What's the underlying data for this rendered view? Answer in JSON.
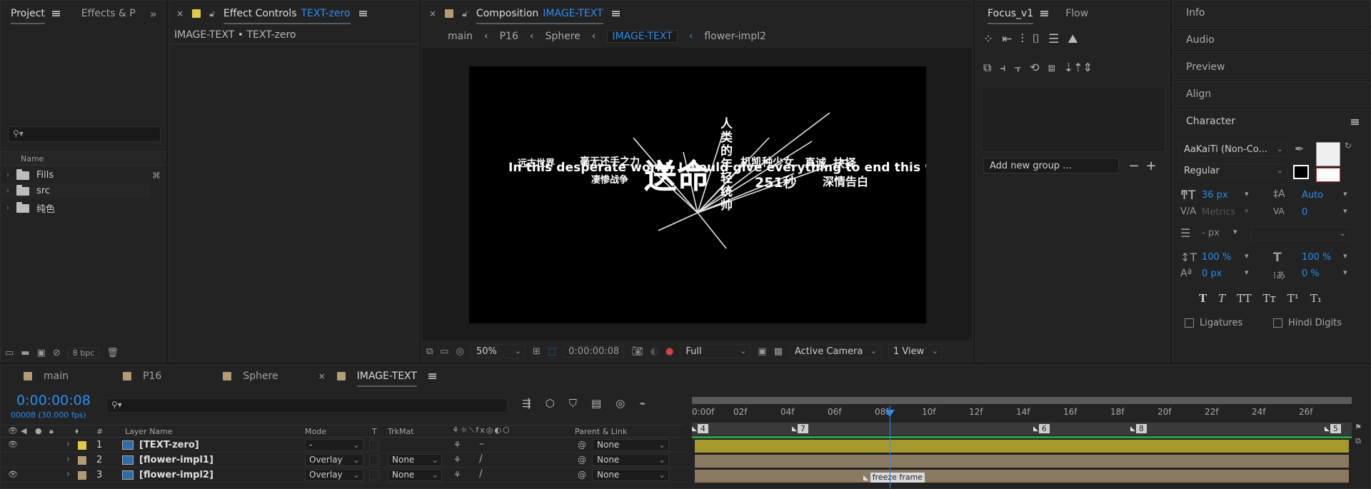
{
  "colors": {
    "accent": "#2d8ceb",
    "label_yellow": "#e0c84a",
    "label_tan": "#b59b73",
    "layer_bar_yellow": "#a7982e",
    "layer_bar_tan": "#8a7a62",
    "green_bar": "#2aa14a"
  },
  "project": {
    "tabs": [
      {
        "label": "Project"
      },
      {
        "label": "Effects & P"
      }
    ],
    "search_placeholder": "",
    "col_name": "Name",
    "items": [
      {
        "label": "Fills"
      },
      {
        "label": "src"
      },
      {
        "label": "纯色"
      }
    ],
    "bpc": "8 bpc"
  },
  "effect_controls": {
    "title": "Effect Controls",
    "title_target": "TEXT-zero",
    "subtitle": "IMAGE-TEXT • TEXT-zero"
  },
  "composition": {
    "title": "Composition",
    "title_target": "IMAGE-TEXT",
    "breadcrumbs": [
      {
        "label": "main"
      },
      {
        "label": "P16"
      },
      {
        "label": "Sphere"
      },
      {
        "label": "IMAGE-TEXT"
      },
      {
        "label": "flower-impl2"
      }
    ],
    "zoom": "50%",
    "timecode": "0:00:00:08",
    "resolution": "Full",
    "camera": "Active Camera",
    "view": "1 View",
    "canvas_texts": {
      "line_en": "In this desperate world, I would give everything to end this war.",
      "t1": "远古世界",
      "t2": "毫无还手之力",
      "t3": "凄惨战争",
      "t4": "送命",
      "t5": "机凯种少女",
      "t6": "真诚",
      "t7": "抉择",
      "t8": "251秒",
      "t9": "深情告白",
      "vertical": "人类的年轻统帅"
    }
  },
  "focus": {
    "tabs": [
      {
        "label": "Focus_v1"
      },
      {
        "label": "Flow"
      }
    ],
    "group_placeholder": "Add new group ..."
  },
  "right_panels": [
    {
      "label": "Info"
    },
    {
      "label": "Audio"
    },
    {
      "label": "Preview"
    },
    {
      "label": "Align"
    }
  ],
  "character": {
    "title": "Character",
    "font": "AaKaiTi (Non-Co...",
    "style": "Regular",
    "size": "36 px",
    "leading": "Auto",
    "kerning": "Metrics",
    "tracking": "0",
    "stroke": "- px",
    "vscale": "100 %",
    "hscale": "100 %",
    "baseline": "0 px",
    "tsume": "0 %",
    "styles": [
      "T",
      "T",
      "TT",
      "Tт",
      "T¹",
      "T₁"
    ],
    "ligatures": "Ligatures",
    "hindi": "Hindi Digits"
  },
  "timeline": {
    "tabs": [
      {
        "label": "main"
      },
      {
        "label": "P16"
      },
      {
        "label": "Sphere"
      },
      {
        "label": "IMAGE-TEXT"
      }
    ],
    "timecode": "0:00:00:08",
    "frames": "00008 (30.000 fps)",
    "headers": {
      "num": "#",
      "layer_name": "Layer Name",
      "mode": "Mode",
      "t": "T",
      "trkmat": "TrkMat",
      "parent": "Parent & Link"
    },
    "ruler": [
      "0:00f",
      "02f",
      "04f",
      "06f",
      "08f",
      "10f",
      "12f",
      "14f",
      "16f",
      "18f",
      "20f",
      "22f",
      "24f",
      "26f"
    ],
    "markers": [
      "4",
      "7",
      "6",
      "8",
      "5"
    ],
    "layers": [
      {
        "num": "1",
        "name": "[TEXT-zero]",
        "mode": "-",
        "trkmat": "",
        "parent": "None"
      },
      {
        "num": "2",
        "name": "[flower-impl1]",
        "mode": "Overlay",
        "trkmat": "None",
        "parent": "None"
      },
      {
        "num": "3",
        "name": "[flower-impl2]",
        "mode": "Overlay",
        "trkmat": "None",
        "parent": "None"
      }
    ],
    "freeze_label": "freeze frame"
  }
}
